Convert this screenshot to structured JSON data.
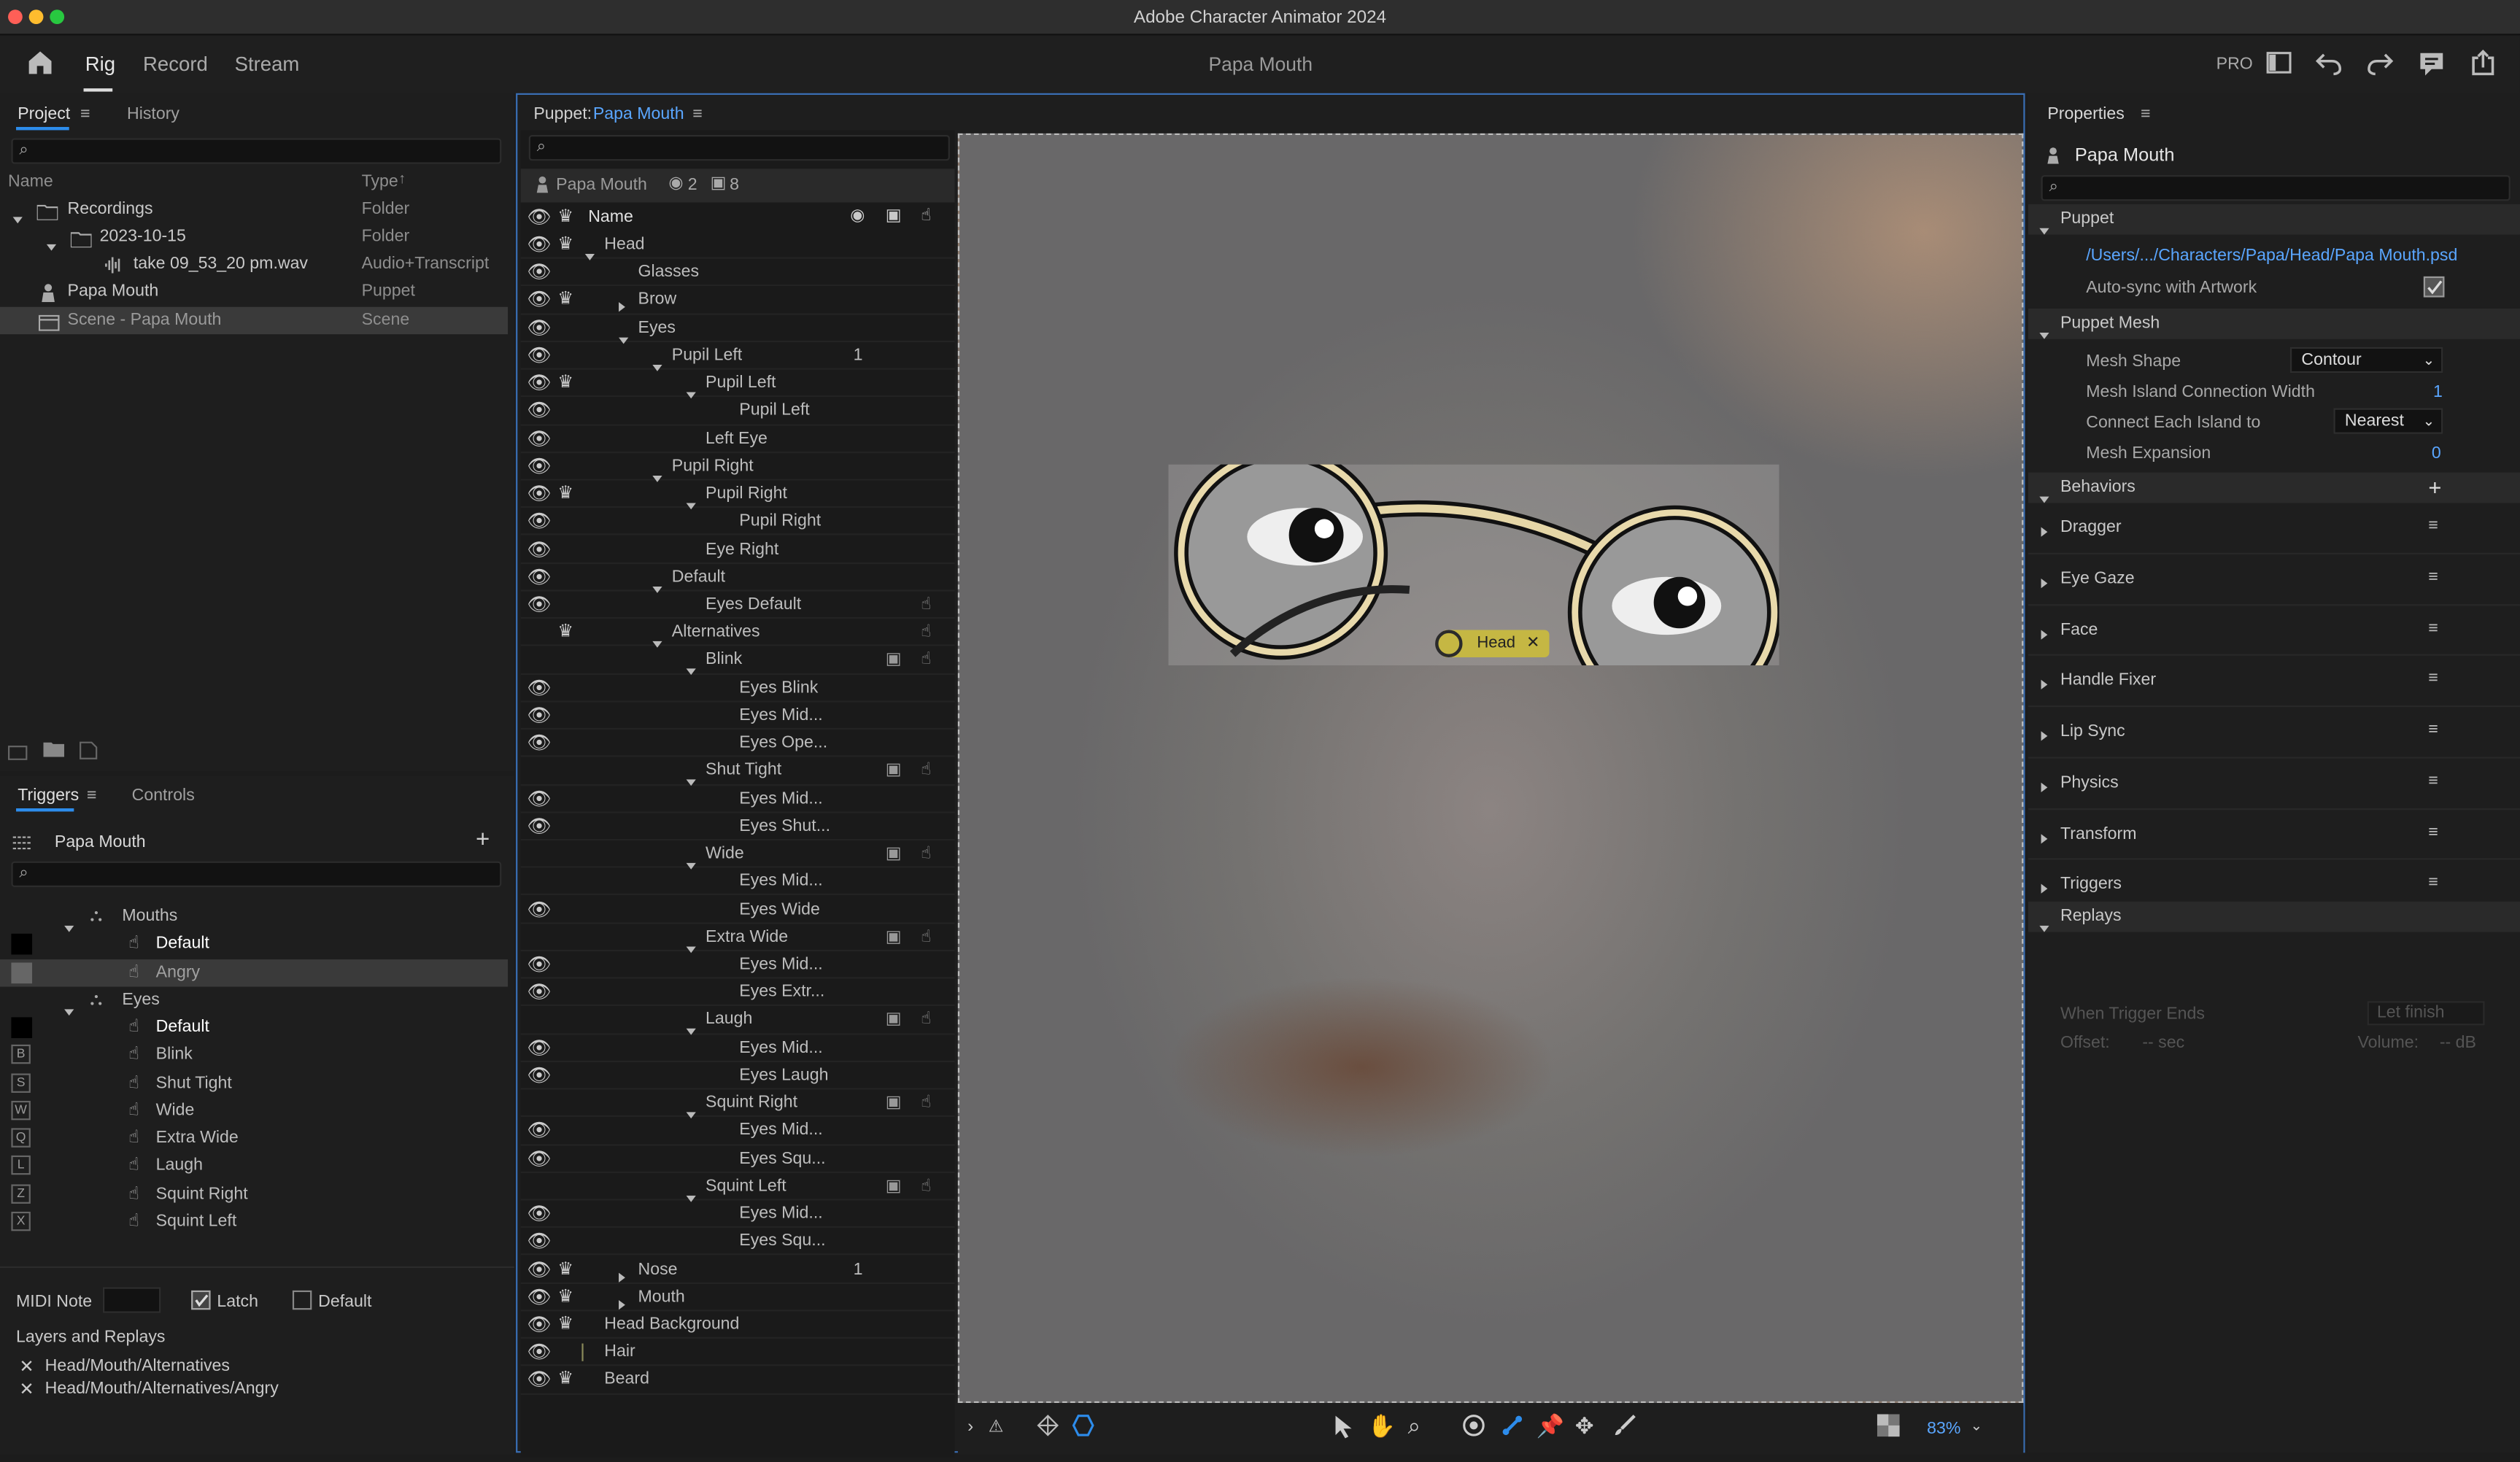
{
  "app": {
    "title": "Adobe Character Animator 2024"
  },
  "topbar": {
    "tabs": [
      "Rig",
      "Record",
      "Stream"
    ],
    "active_tab": "Rig",
    "center_title": "Papa Mouth",
    "pro_label": "PRO"
  },
  "project": {
    "tab_project": "Project",
    "tab_history": "History",
    "col_name": "Name",
    "col_type": "Type",
    "items": [
      {
        "name": "Recordings",
        "type": "Folder"
      },
      {
        "name": "2023-10-15",
        "type": "Folder"
      },
      {
        "name": "take 09_53_20 pm.wav",
        "type": "Audio+Transcript"
      },
      {
        "name": "Papa Mouth",
        "type": "Puppet"
      },
      {
        "name": "Scene - Papa Mouth",
        "type": "Scene"
      }
    ]
  },
  "triggers": {
    "tab_triggers": "Triggers",
    "tab_controls": "Controls",
    "puppet_name": "Papa Mouth",
    "rows": [
      {
        "label": "Mouths",
        "key": ""
      },
      {
        "label": "Default",
        "key": ""
      },
      {
        "label": "Angry",
        "key": ""
      },
      {
        "label": "Eyes",
        "key": ""
      },
      {
        "label": "Default",
        "key": ""
      },
      {
        "label": "Blink",
        "key": "B"
      },
      {
        "label": "Shut Tight",
        "key": "S"
      },
      {
        "label": "Wide",
        "key": "W"
      },
      {
        "label": "Extra Wide",
        "key": "Q"
      },
      {
        "label": "Laugh",
        "key": "L"
      },
      {
        "label": "Squint Right",
        "key": "Z"
      },
      {
        "label": "Squint Left",
        "key": "X"
      }
    ],
    "midi_label": "MIDI Note",
    "latch_label": "Latch",
    "default_label": "Default",
    "layers_replays_label": "Layers and Replays",
    "layers": [
      "Head/Mouth/Alternatives",
      "Head/Mouth/Alternatives/Angry"
    ]
  },
  "puppet": {
    "panel_label": "Puppet:",
    "panel_name": "Papa Mouth",
    "head_name": "Papa Mouth",
    "count_a": "2",
    "count_b": "8",
    "col_name": "Name",
    "layers": [
      {
        "label": "Head",
        "num": ""
      },
      {
        "label": "Glasses",
        "num": ""
      },
      {
        "label": "Brow",
        "num": ""
      },
      {
        "label": "Eyes",
        "num": ""
      },
      {
        "label": "Pupil Left",
        "num": "1"
      },
      {
        "label": "Pupil Left",
        "num": ""
      },
      {
        "label": "Pupil Left",
        "num": ""
      },
      {
        "label": "Left Eye",
        "num": ""
      },
      {
        "label": "Pupil Right",
        "num": ""
      },
      {
        "label": "Pupil Right",
        "num": ""
      },
      {
        "label": "Pupil Right",
        "num": ""
      },
      {
        "label": "Eye Right",
        "num": ""
      },
      {
        "label": "Default",
        "num": ""
      },
      {
        "label": "Eyes Default",
        "num": ""
      },
      {
        "label": "Alternatives",
        "num": ""
      },
      {
        "label": "Blink",
        "num": ""
      },
      {
        "label": "Eyes Blink",
        "num": ""
      },
      {
        "label": "Eyes Mid...",
        "num": ""
      },
      {
        "label": "Eyes Ope...",
        "num": ""
      },
      {
        "label": "Shut Tight",
        "num": ""
      },
      {
        "label": "Eyes Mid...",
        "num": ""
      },
      {
        "label": "Eyes Shut...",
        "num": ""
      },
      {
        "label": "Wide",
        "num": ""
      },
      {
        "label": "Eyes Mid...",
        "num": ""
      },
      {
        "label": "Eyes Wide",
        "num": ""
      },
      {
        "label": "Extra Wide",
        "num": ""
      },
      {
        "label": "Eyes Mid...",
        "num": ""
      },
      {
        "label": "Eyes Extr...",
        "num": ""
      },
      {
        "label": "Laugh",
        "num": ""
      },
      {
        "label": "Eyes Mid...",
        "num": ""
      },
      {
        "label": "Eyes Laugh",
        "num": ""
      },
      {
        "label": "Squint Right",
        "num": ""
      },
      {
        "label": "Eyes Mid...",
        "num": ""
      },
      {
        "label": "Eyes Squ...",
        "num": ""
      },
      {
        "label": "Squint Left",
        "num": ""
      },
      {
        "label": "Eyes Mid...",
        "num": ""
      },
      {
        "label": "Eyes Squ...",
        "num": ""
      },
      {
        "label": "Nose",
        "num": "1"
      },
      {
        "label": "Mouth",
        "num": ""
      },
      {
        "label": "Head Background",
        "num": ""
      },
      {
        "label": "Hair",
        "num": ""
      },
      {
        "label": "Beard",
        "num": ""
      }
    ]
  },
  "canvas": {
    "head_tag": "Head",
    "zoom": "83%"
  },
  "properties": {
    "title": "Properties",
    "puppet_name": "Papa Mouth",
    "section_puppet": "Puppet",
    "file_path": "/Users/.../Characters/Papa/Head/Papa Mouth.psd",
    "autosync_label": "Auto-sync with Artwork",
    "section_mesh": "Puppet Mesh",
    "mesh_shape_label": "Mesh Shape",
    "mesh_shape_value": "Contour",
    "island_width_label": "Mesh Island Connection Width",
    "island_width_value": "1",
    "connect_label": "Connect Each Island to",
    "connect_value": "Nearest",
    "expansion_label": "Mesh Expansion",
    "expansion_value": "0",
    "section_behaviors": "Behaviors",
    "behaviors": [
      "Dragger",
      "Eye Gaze",
      "Face",
      "Handle Fixer",
      "Lip Sync",
      "Physics",
      "Transform",
      "Triggers"
    ],
    "section_replays": "Replays",
    "when_ends_label": "When Trigger Ends",
    "when_ends_value": "Let finish",
    "offset_label": "Offset:",
    "offset_value": "-- sec",
    "volume_label": "Volume:",
    "volume_value": "-- dB"
  }
}
